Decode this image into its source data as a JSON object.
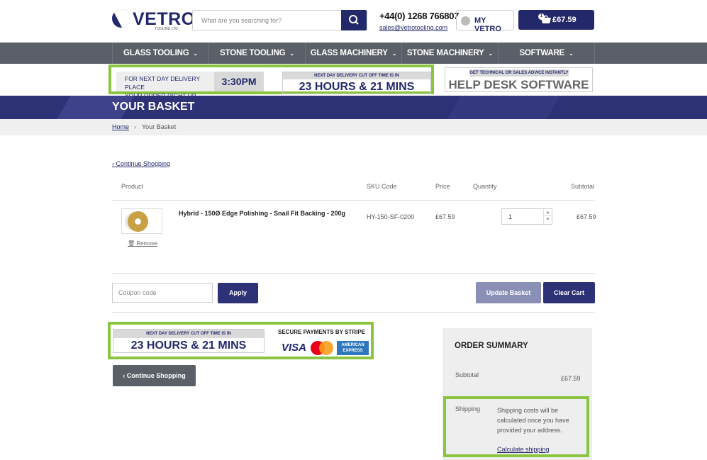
{
  "header": {
    "logo_text": "VETRO",
    "logo_sub": "TOOLING LTD",
    "search_placeholder": "What are you searching for?",
    "phone": "+44(0) 1268 766807",
    "email": "sales@vetrotooling.com",
    "account_label": "MY VETRO",
    "cart_count": "1",
    "cart_total": "£67.59"
  },
  "nav": {
    "items": [
      "GLASS TOOLING",
      "STONE TOOLING",
      "GLASS MACHINERY",
      "STONE MACHINERY",
      "SOFTWARE"
    ]
  },
  "banner": {
    "left_line1": "FOR NEXT DAY DELIVERY PLACE",
    "left_line2": "YOUR ORDER RIGHT UP UNTIL",
    "cutoff_time": "3:30PM",
    "countdown_caption": "NEXT DAY DELIVERY CUT OFF TIME IS IN",
    "countdown": "23 HOURS & 21 MINS",
    "help_caption": "GET TECHNICAL OR SALES ADVICE INSTANTLY",
    "help_title": "HELP DESK SOFTWARE"
  },
  "page": {
    "title": "YOUR BASKET",
    "breadcrumb_home": "Home",
    "breadcrumb_sep": "›",
    "breadcrumb_current": "Your Basket",
    "continue_link": "‹ Continue Shopping"
  },
  "table": {
    "headers": [
      "Product",
      "SKU Code",
      "Price",
      "Quantity",
      "Subtotal"
    ],
    "rows": [
      {
        "name": "Hybrid - 150Ø Edge Polishing - Snail Fit Backing - 200g",
        "sku": "HY-150-SF-0200",
        "price": "£67.59",
        "quantity": "1",
        "subtotal": "£67.59",
        "remove_label": "Remove"
      }
    ]
  },
  "actions": {
    "coupon_placeholder": "Coupon code",
    "apply_label": "Apply",
    "update_label": "Update Basket",
    "clear_label": "Clear Cart",
    "continue_button": "‹ Continue Shopping"
  },
  "payments": {
    "countdown_caption": "NEXT DAY DELIVERY CUT OFF TIME IS IN",
    "countdown": "23 HOURS & 21 MINS",
    "secure_label": "SECURE PAYMENTS BY STRIPE",
    "visa": "VISA",
    "amex": "AMERICAN EXPRESS"
  },
  "summary": {
    "title": "ORDER SUMMARY",
    "subtotal_label": "Subtotal",
    "subtotal_value": "£67.59",
    "shipping_label": "Shipping",
    "shipping_text": "Shipping costs will be calculated once you have provided your address.",
    "shipping_link": "Calculate shipping"
  },
  "colors": {
    "brand_navy": "#23286b",
    "nav_gray": "#5b6068",
    "highlight_green": "#8bc53f"
  }
}
